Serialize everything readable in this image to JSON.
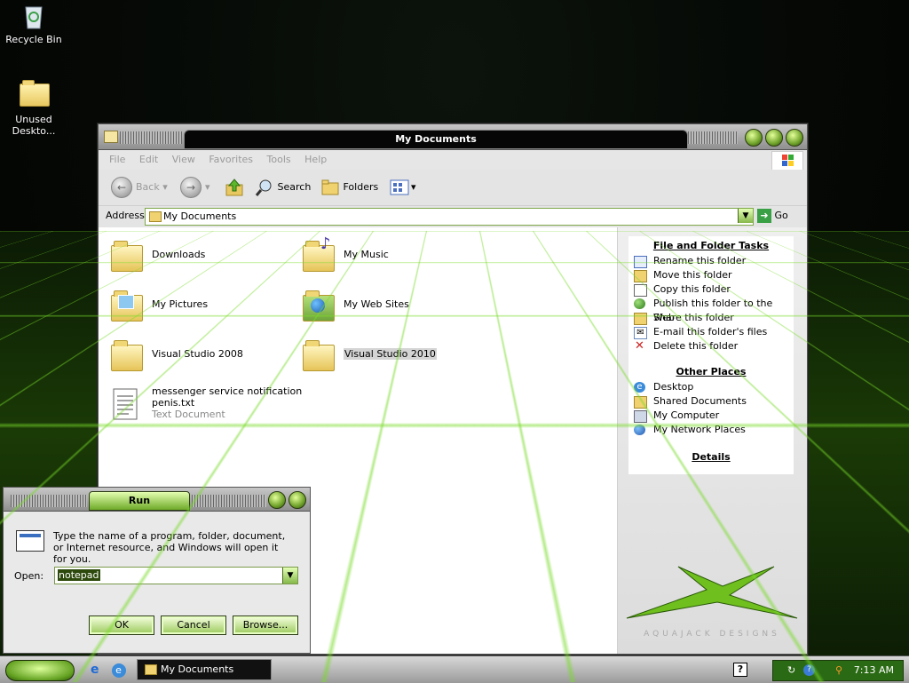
{
  "desktop": {
    "icons": [
      {
        "label": "Recycle Bin"
      },
      {
        "label": "Unused Deskto..."
      }
    ]
  },
  "explorer": {
    "title": "My Documents",
    "menu": [
      "File",
      "Edit",
      "View",
      "Favorites",
      "Tools",
      "Help"
    ],
    "toolbar": {
      "back_label": "Back",
      "search_label": "Search",
      "folders_label": "Folders"
    },
    "address": {
      "label": "Address",
      "value": "My Documents",
      "go_label": "Go"
    },
    "items": [
      {
        "name": "Downloads"
      },
      {
        "name": "My Music"
      },
      {
        "name": "My Pictures"
      },
      {
        "name": "My Web Sites"
      },
      {
        "name": "Visual Studio 2008"
      },
      {
        "name": "Visual Studio 2010"
      },
      {
        "name": "messenger service notification penis.txt",
        "line1": "messenger service notification",
        "line2": "penis.txt",
        "type": "Text Document"
      }
    ],
    "sidebar": {
      "file_tasks_title": "File and Folder Tasks",
      "file_tasks": [
        "Rename this folder",
        "Move this folder",
        "Copy this folder",
        "Publish this folder to the Web",
        "Share this folder",
        "E-mail this folder's files",
        "Delete this folder"
      ],
      "other_places_title": "Other Places",
      "other_places": [
        "Desktop",
        "Shared Documents",
        "My Computer",
        "My Network Places"
      ],
      "details_title": "Details",
      "watermark": "AQUAJACK DESIGNS"
    }
  },
  "run_dialog": {
    "title": "Run",
    "description": "Type the name of a program, folder, document, or Internet resource, and Windows will open it for you.",
    "open_label": "Open:",
    "open_value": "notepad",
    "ok_label": "OK",
    "cancel_label": "Cancel",
    "browse_label": "Browse..."
  },
  "taskbar": {
    "active_window_label": "My Documents",
    "clock": "7:13 AM"
  }
}
